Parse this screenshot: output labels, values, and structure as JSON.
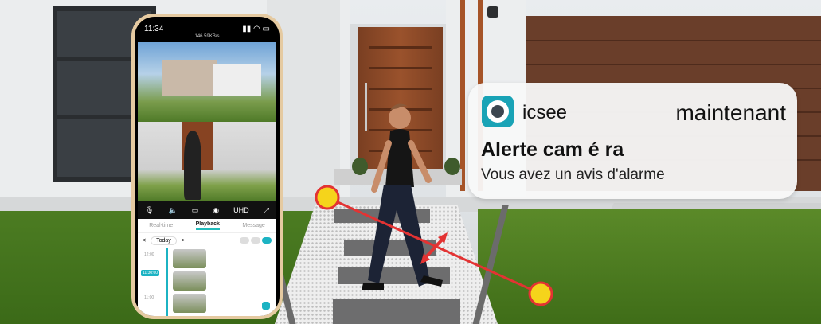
{
  "phone": {
    "status_time": "11:34",
    "net_speed": "146.59KB/s",
    "toolbar": {
      "mic_icon": "mic-icon",
      "speaker_icon": "speaker-icon",
      "record_icon": "record-icon",
      "snapshot_icon": "camera-icon",
      "quality_label": "UHD"
    },
    "tabs": [
      {
        "label": "Real-time",
        "active": false
      },
      {
        "label": "Playback",
        "active": true
      },
      {
        "label": "Message",
        "active": false
      }
    ],
    "date_selector": {
      "prev_label": "<",
      "date_label": "Today",
      "next_label": ">"
    },
    "timeline": {
      "times": [
        "12:00",
        "11:30:00",
        "11:00"
      ],
      "current_time": "11:30:00"
    }
  },
  "notification": {
    "app_name": "icsee",
    "time": "maintenant",
    "title": "Alerte cam é ra",
    "body": "Vous avez un avis d'alarme"
  },
  "colors": {
    "accent": "#1cb3c3",
    "marker_fill": "#f5d41b",
    "marker_line": "#e33333"
  }
}
